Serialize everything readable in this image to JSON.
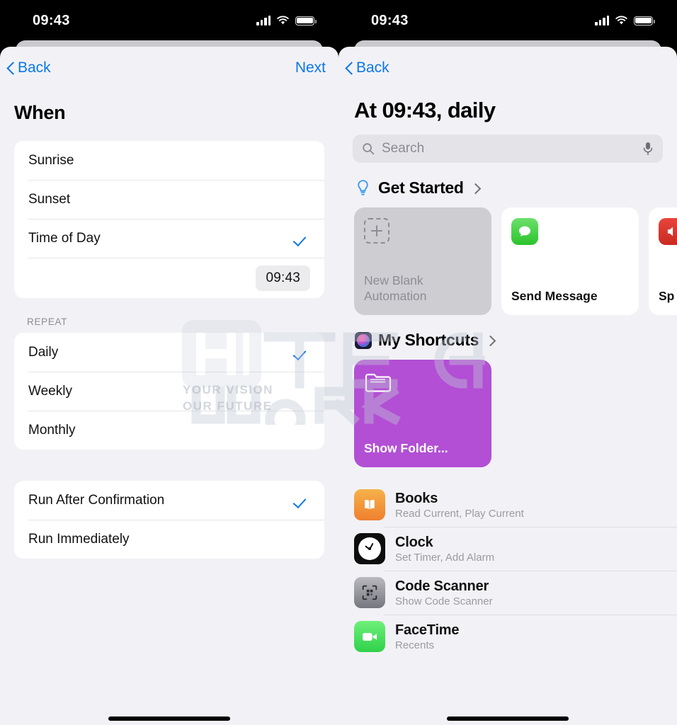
{
  "status_bar": {
    "time": "09:43",
    "icons": [
      "cellular-bars-icon",
      "wifi-icon",
      "battery-icon"
    ]
  },
  "left_panel": {
    "nav": {
      "back_label": "Back",
      "next_label": "Next"
    },
    "title": "When",
    "trigger_group": {
      "items": [
        {
          "label": "Sunrise",
          "checked": false
        },
        {
          "label": "Sunset",
          "checked": false
        },
        {
          "label": "Time of Day",
          "checked": true
        }
      ],
      "time_value": "09:43"
    },
    "repeat_header": "REPEAT",
    "repeat_group": {
      "items": [
        {
          "label": "Daily",
          "checked": true
        },
        {
          "label": "Weekly",
          "checked": false
        },
        {
          "label": "Monthly",
          "checked": false
        }
      ]
    },
    "run_group": {
      "items": [
        {
          "label": "Run After Confirmation",
          "checked": true
        },
        {
          "label": "Run Immediately",
          "checked": false
        }
      ]
    }
  },
  "right_panel": {
    "nav": {
      "back_label": "Back"
    },
    "title": "At 09:43, daily",
    "search": {
      "placeholder": "Search",
      "icon": "search-icon",
      "mic_icon": "microphone-icon"
    },
    "get_started": {
      "icon": "lightbulb-icon",
      "title": "Get Started",
      "cards": [
        {
          "label": "New Blank Automation",
          "icon": "dashed-plus-icon",
          "bg": "#cdcdd2"
        },
        {
          "label": "Send Message",
          "icon": "messages-app-icon",
          "bg": "#ffffff",
          "icon_color": "#4cd964"
        },
        {
          "label": "Sp",
          "icon": "speaker-app-icon",
          "bg": "#ffffff",
          "icon_color": "#e03131"
        }
      ]
    },
    "my_shortcuts": {
      "icon": "shortcuts-app-icon",
      "title": "My Shortcuts",
      "card": {
        "label": "Show Folder...",
        "icon": "folder-icon",
        "bg": "#b24fd4"
      }
    },
    "apps": [
      {
        "name": "Books",
        "subtitle": "Read Current, Play Current",
        "icon": "books-app-icon",
        "color": "#f2a13c"
      },
      {
        "name": "Clock",
        "subtitle": "Set Timer, Add Alarm",
        "icon": "clock-app-icon",
        "color": "#0a0a0a"
      },
      {
        "name": "Code Scanner",
        "subtitle": "Show Code Scanner",
        "icon": "code-scanner-app-icon",
        "color": "#9a9aa0"
      },
      {
        "name": "FaceTime",
        "subtitle": "Recents",
        "icon": "facetime-app-icon",
        "color": "#5ee070"
      }
    ]
  },
  "watermark": {
    "logo_text_1": "HI",
    "logo_text_2": "TECH",
    "logo_text_3": "WORK",
    "tagline_1": "YOUR VISION",
    "tagline_2": "OUR FUTURE"
  },
  "colors": {
    "accent_blue": "#0a76ec",
    "bg": "#f2f2f6",
    "card": "#ffffff",
    "purple": "#b24fd4"
  }
}
